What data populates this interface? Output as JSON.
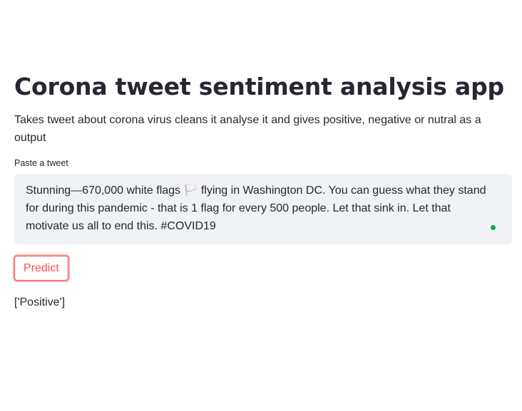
{
  "page": {
    "title": "Corona tweet sentiment analysis app",
    "description": "Takes tweet about corona virus cleans it analyse it and gives positive, negative or nutral as a output"
  },
  "tweet_input": {
    "label": "Paste a tweet",
    "value": "Stunning—670,000 white flags 🏳️ flying in Washington DC. You can guess what they stand for during this pandemic - that is 1 flag for every 500 people. Let that sink in. Let that motivate us all to end this. #COVID19"
  },
  "predict_button": {
    "label": "Predict"
  },
  "result": {
    "text": "['Positive']"
  },
  "colors": {
    "accent": "#ff4b4b",
    "input_background": "#f0f2f6",
    "status_dot": "#09ab3b",
    "text": "#262730"
  }
}
